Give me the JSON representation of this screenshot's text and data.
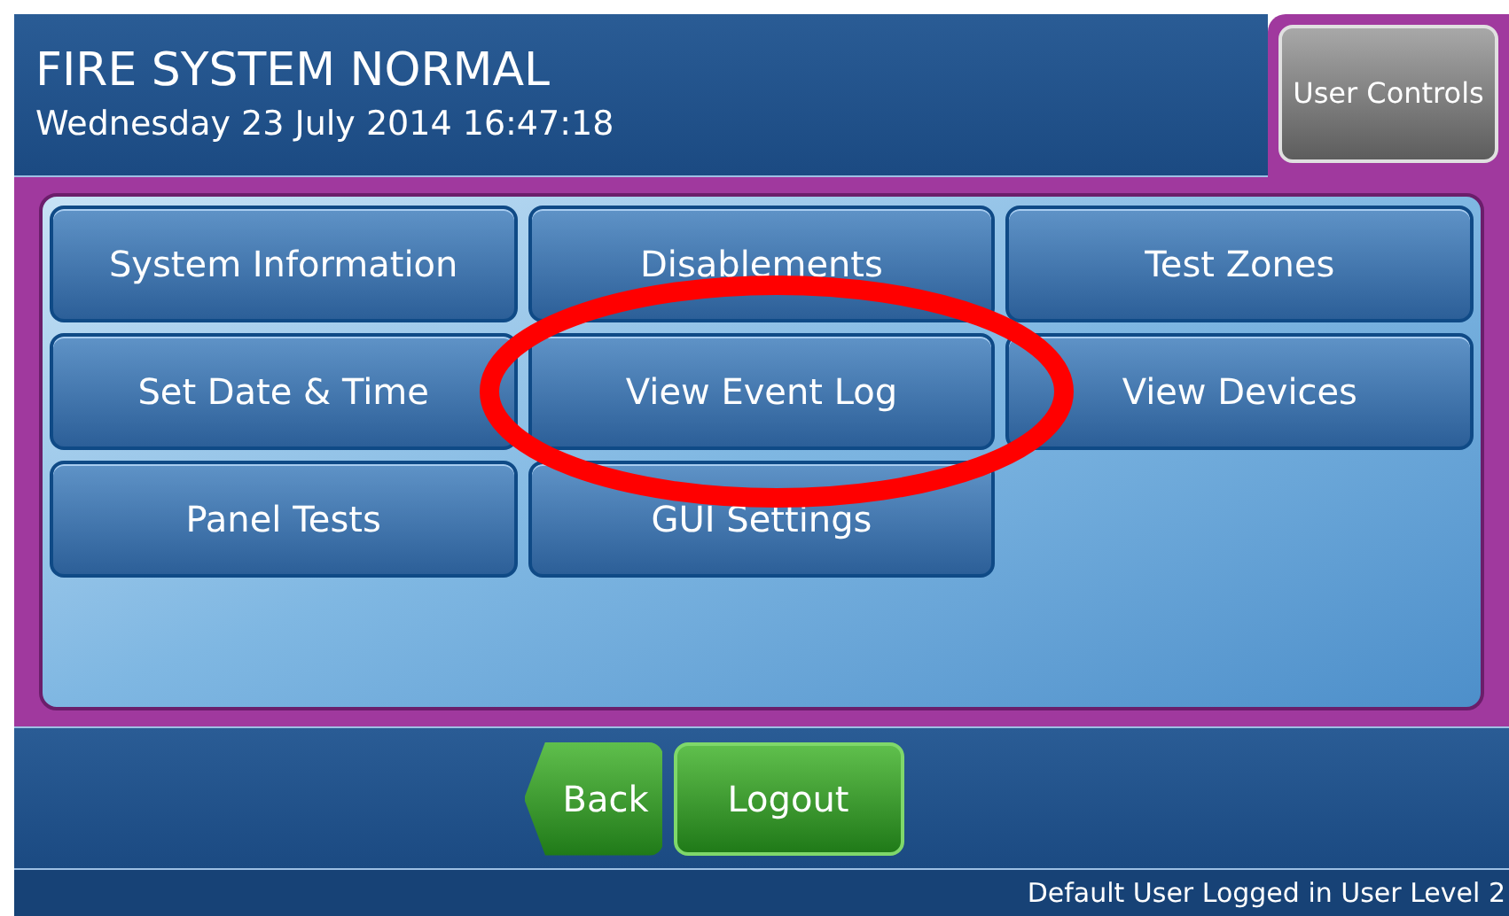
{
  "header": {
    "title": "FIRE SYSTEM NORMAL",
    "datetime": "Wednesday 23 July 2014 16:47:18"
  },
  "user_controls_tab": {
    "label": "User Controls",
    "selected": true
  },
  "menu_buttons": [
    {
      "label": "System Information"
    },
    {
      "label": "Disablements"
    },
    {
      "label": "Test Zones"
    },
    {
      "label": "Set Date & Time"
    },
    {
      "label": "View Event Log"
    },
    {
      "label": "View Devices"
    },
    {
      "label": "Panel Tests"
    },
    {
      "label": "GUI Settings"
    }
  ],
  "nav_buttons": [
    {
      "kind": "back",
      "label": "Back"
    },
    {
      "kind": "plain",
      "label": "Logout"
    }
  ],
  "status_bar": "Default User Logged in User Level 2"
}
